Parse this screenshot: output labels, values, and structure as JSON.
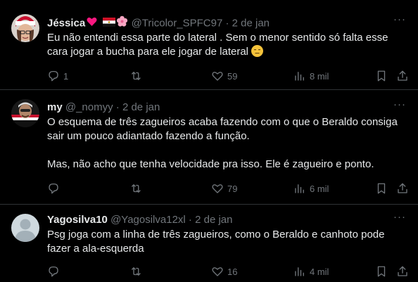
{
  "tweets": [
    {
      "name": "Jéssica",
      "handle": "@Tricolor_SPFC97",
      "separator": "·",
      "date": "2 de jan",
      "text": "Eu não entendi essa parte do lateral . Sem o menor sentido só falta esse cara jogar a bucha para ele jogar de lateral",
      "replies": "1",
      "retweets": "",
      "likes": "59",
      "views": "8 mil"
    },
    {
      "name": "my",
      "handle": "@_nomyy",
      "separator": "·",
      "date": "2 de jan",
      "text": "O esquema de três zagueiros acaba fazendo com o que o Beraldo consiga sair um pouco adiantado fazendo a função.\n\nMas, não acho que tenha velocidade pra isso. Ele é zagueiro e ponto.",
      "replies": "",
      "retweets": "",
      "likes": "79",
      "views": "6 mil"
    },
    {
      "name": "Yagosilva10",
      "handle": "@Yagosilva12xl",
      "separator": "·",
      "date": "2 de jan",
      "text": "Psg joga com a linha de três zagueiros, como o Beraldo e canhoto pode fazer a ala-esquerda",
      "replies": "",
      "retweets": "",
      "likes": "16",
      "views": "4 mil"
    }
  ],
  "icons": [
    "reply-icon",
    "retweet-icon",
    "like-icon",
    "views-icon",
    "bookmark-icon",
    "share-icon",
    "more-icon",
    "heart-emoji",
    "egypt-flag-emoji",
    "flower-emoji",
    "expressionless-emoji"
  ],
  "colors": {
    "background": "#000000",
    "text": "#e7e9ea",
    "muted": "#71767b",
    "border": "#2f3336",
    "heart": "#f91880"
  }
}
